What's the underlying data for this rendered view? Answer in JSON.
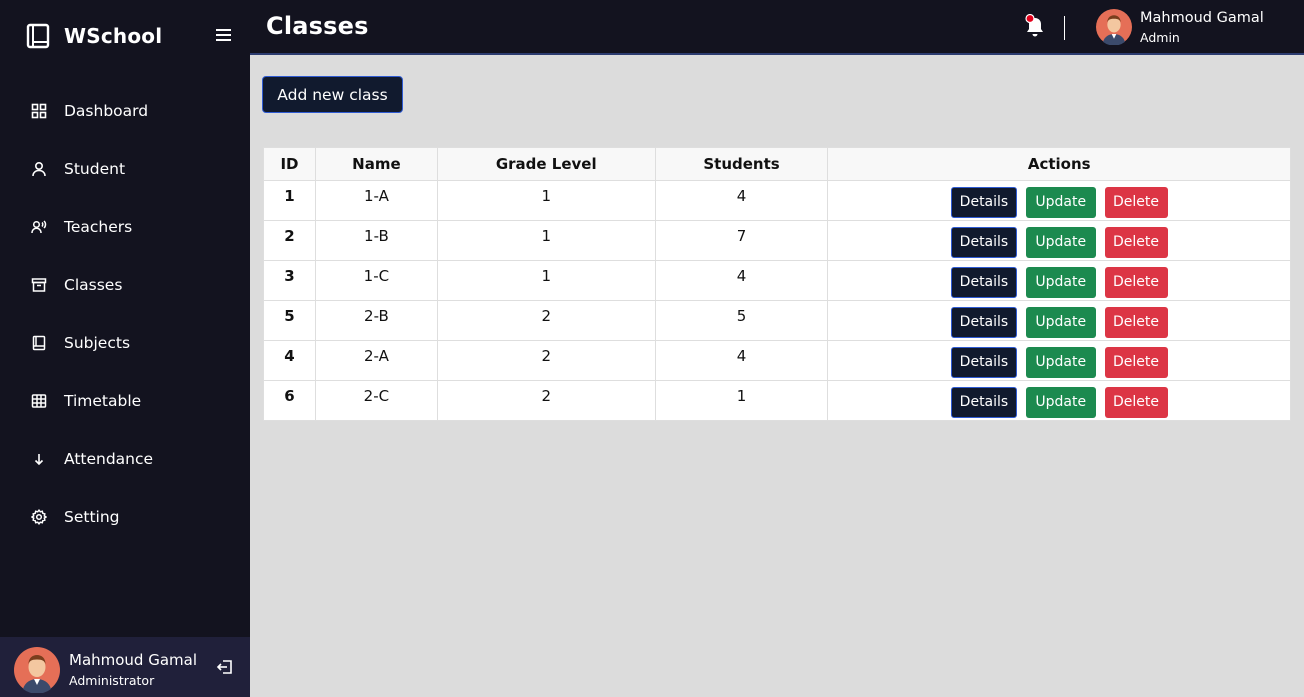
{
  "app": {
    "name": "WSchool"
  },
  "sidebar": {
    "items": [
      {
        "label": "Dashboard",
        "icon": "dashboard-grid-icon"
      },
      {
        "label": "Student",
        "icon": "user-icon"
      },
      {
        "label": "Teachers",
        "icon": "teacher-icon"
      },
      {
        "label": "Classes",
        "icon": "archive-box-icon"
      },
      {
        "label": "Subjects",
        "icon": "book-icon"
      },
      {
        "label": "Timetable",
        "icon": "table-grid-icon"
      },
      {
        "label": "Attendance",
        "icon": "arrow-down-icon"
      },
      {
        "label": "Setting",
        "icon": "gear-icon"
      }
    ],
    "user": {
      "name": "Mahmoud Gamal",
      "role": "Administrator"
    }
  },
  "header": {
    "title": "Classes",
    "user": {
      "name": "Mahmoud Gamal",
      "role": "Admin"
    }
  },
  "main": {
    "add_button": "Add new class",
    "table": {
      "columns": [
        "ID",
        "Name",
        "Grade Level",
        "Students",
        "Actions"
      ],
      "rows": [
        {
          "id": "1",
          "name": "1-A",
          "grade": "1",
          "students": "4"
        },
        {
          "id": "2",
          "name": "1-B",
          "grade": "1",
          "students": "7"
        },
        {
          "id": "3",
          "name": "1-C",
          "grade": "1",
          "students": "4"
        },
        {
          "id": "5",
          "name": "2-B",
          "grade": "2",
          "students": "5"
        },
        {
          "id": "4",
          "name": "2-A",
          "grade": "2",
          "students": "4"
        },
        {
          "id": "6",
          "name": "2-C",
          "grade": "2",
          "students": "1"
        }
      ],
      "actions": {
        "details": "Details",
        "update": "Update",
        "delete": "Delete"
      }
    }
  },
  "colors": {
    "sidebar_bg": "#13131f",
    "content_bg": "#dcdcdc",
    "details_btn": "#111a2e",
    "update_btn": "#1c8a4f",
    "delete_btn": "#dc3545",
    "notification_dot": "#e3001b"
  }
}
